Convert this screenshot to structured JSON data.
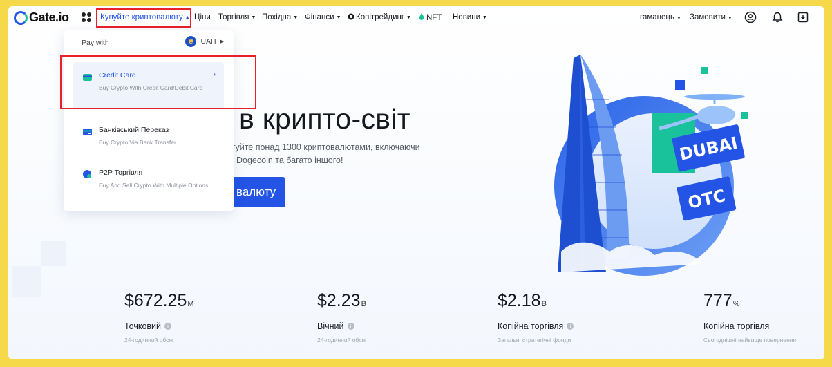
{
  "brand": {
    "name": "Gate.io",
    "color": "#2354e6"
  },
  "nav": {
    "items": [
      {
        "label": "Купуйте криптовалюту",
        "caret": "▲",
        "active": true
      },
      {
        "label": "Ціни",
        "caret": ""
      },
      {
        "label": "Торгівля",
        "caret": "▼"
      },
      {
        "label": "Похідна",
        "caret": "▼"
      },
      {
        "label": "Фінанси",
        "caret": "▼"
      },
      {
        "label": "Копітрейдинг",
        "caret": "▼"
      },
      {
        "label": "NFT",
        "caret": ""
      },
      {
        "label": "Новини",
        "caret": "▼"
      }
    ],
    "wallet": "гаманець",
    "orders": "Замовити",
    "icons": [
      "apps-icon",
      "user-icon",
      "bell-icon",
      "download-icon"
    ]
  },
  "dropdown": {
    "pay_with": "Pay with",
    "currency": "UAH",
    "items": [
      {
        "title": "Credit Card",
        "sub": "Buy Crypto With Credit Card/Debit Card",
        "icon": "credit-card-icon"
      },
      {
        "title": "Банківський Переказ",
        "sub": "Buy Crypto Via Bank Transfer",
        "icon": "bank-transfer-icon"
      },
      {
        "title": "P2P Торгівля",
        "sub": "Buy And Sell Crypto With Multiple Options",
        "icon": "p2p-icon"
      }
    ]
  },
  "hero": {
    "title": "в крипто-світ",
    "sub_line1": "оргуйте понад 1300 криптовалютами, включаючи",
    "sub_line2": "Dogecoin та багато іншого!",
    "button": "валюту"
  },
  "illustration": {
    "line1": "DUBAI",
    "line2": "OTC"
  },
  "stats": [
    {
      "value": "$672.25",
      "unit": "M",
      "label": "Точковий",
      "desc": "24-годинний обсяг"
    },
    {
      "value": "$2.23",
      "unit": "B",
      "label": "Вічний",
      "desc": "24-годинний обсяг"
    },
    {
      "value": "$2.18",
      "unit": "B",
      "label": "Копійна торгівля",
      "desc": "Загальні стратегічні фонди"
    },
    {
      "value": "777",
      "unit": "%",
      "label": "Копійна торгівля",
      "desc": "Сьогоднішні найвище повернення"
    }
  ],
  "colors": {
    "accent": "#2354e6",
    "highlight": "#e8202a",
    "frame": "#f6d94b",
    "green": "#19c29b"
  }
}
